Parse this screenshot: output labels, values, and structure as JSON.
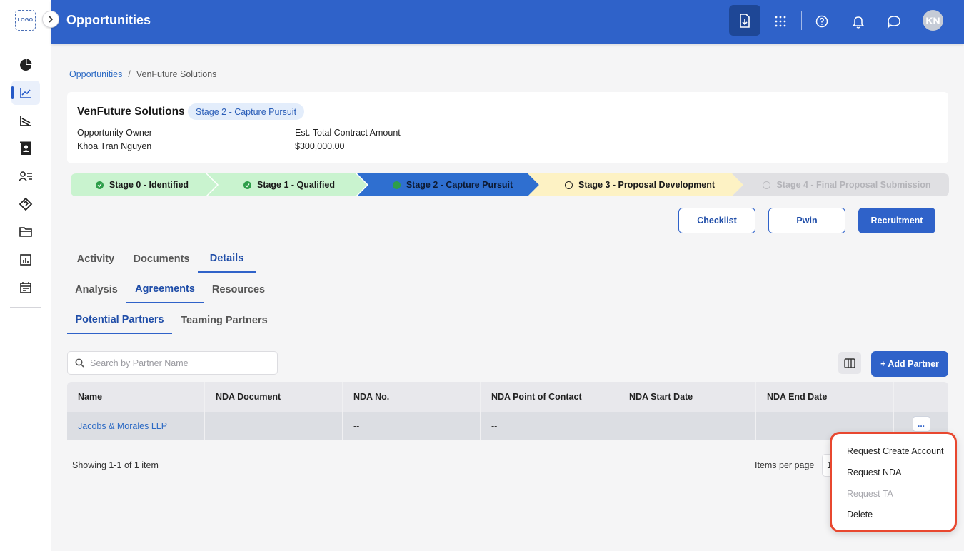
{
  "sidebar": {
    "logo_text": "LOGO",
    "items": [
      {
        "icon": "pie-chart-icon"
      },
      {
        "icon": "line-chart-icon",
        "active": true
      },
      {
        "icon": "funnel-chart-icon"
      },
      {
        "icon": "contact-book-icon"
      },
      {
        "icon": "user-list-icon"
      },
      {
        "icon": "handshake-icon"
      },
      {
        "icon": "folder-icon"
      },
      {
        "icon": "bar-report-icon"
      },
      {
        "icon": "calendar-icon"
      }
    ]
  },
  "header": {
    "title": "Opportunities",
    "avatar_initials": "KN",
    "icons": [
      "export-icon",
      "apps-grid-icon",
      "help-icon",
      "bell-icon",
      "chat-icon"
    ]
  },
  "breadcrumb": {
    "root": "Opportunities",
    "separator": "/",
    "current": "VenFuture Solutions"
  },
  "opportunity": {
    "name": "VenFuture Solutions",
    "stage_badge": "Stage 2 - Capture Pursuit",
    "owner_label": "Opportunity Owner",
    "owner_value": "Khoa Tran Nguyen",
    "amount_label": "Est. Total Contract Amount",
    "amount_value": "$300,000.00"
  },
  "stages": [
    {
      "label": "Stage 0 - Identified",
      "status": "complete"
    },
    {
      "label": "Stage 1 - Qualified",
      "status": "complete"
    },
    {
      "label": "Stage 2 - Capture Pursuit",
      "status": "current"
    },
    {
      "label": "Stage 3 - Proposal Development",
      "status": "next"
    },
    {
      "label": "Stage 4 - Final Proposal Submission",
      "status": "disabled"
    }
  ],
  "actions": {
    "checklist": "Checklist",
    "pwin": "Pwin",
    "recruitment": "Recruitment"
  },
  "tabs_main": [
    "Activity",
    "Documents",
    "Details"
  ],
  "tabs_details": [
    "Analysis",
    "Agreements",
    "Resources"
  ],
  "tabs_agreements": [
    "Potential Partners",
    "Teaming Partners"
  ],
  "search": {
    "placeholder": "Search by Partner Name"
  },
  "add_partner": "+ Add Partner",
  "table": {
    "columns": [
      "Name",
      "NDA Document",
      "NDA No.",
      "NDA Point of Contact",
      "NDA Start Date",
      "NDA End Date"
    ],
    "rows": [
      {
        "name": "Jacobs & Morales LLP",
        "nda_document": "",
        "nda_no": "--",
        "nda_poc": "--",
        "nda_start": "",
        "nda_end": ""
      }
    ],
    "more_label": "..."
  },
  "pagination": {
    "showing": "Showing 1-1 of 1 item",
    "items_per_page_label": "Items per page",
    "items_per_page_value": "1"
  },
  "context_menu": {
    "items": [
      {
        "label": "Request Create Account",
        "enabled": true
      },
      {
        "label": "Request NDA",
        "enabled": true
      },
      {
        "label": "Request TA",
        "enabled": false
      },
      {
        "label": "Delete",
        "enabled": true
      }
    ]
  },
  "colors": {
    "brand": "#2f62c9",
    "stage_complete": "#c9f3cf",
    "stage_current": "#2f6fd0",
    "stage_next": "#fdf2c4",
    "stage_disabled": "#e0e0e3",
    "menu_highlight": "#e8472f"
  }
}
